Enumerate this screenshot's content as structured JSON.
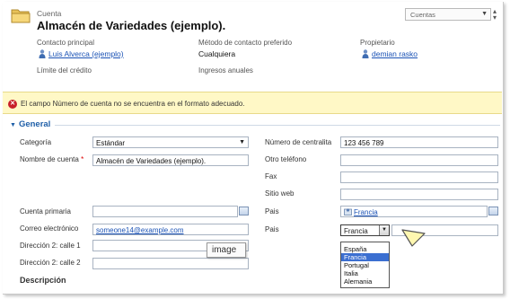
{
  "header": {
    "entity_type": "Cuenta",
    "record_title": "Almacén de Variedades (ejemplo).",
    "nav_dropdown_label": "Cuentas",
    "fields": [
      {
        "label": "Contacto principal",
        "value": "Luis Alverca (ejemplo)"
      },
      {
        "label": "Método de contacto preferido",
        "value": "Cualquiera"
      },
      {
        "label": "Propietario",
        "value": "demian rasko"
      },
      {
        "label": "Límite del crédito",
        "value": ""
      },
      {
        "label": "Ingresos anuales",
        "value": ""
      }
    ]
  },
  "notification": {
    "text": "El campo Número de cuenta no se encuentra en el formato adecuado."
  },
  "section": {
    "title": "General",
    "description_title": "Descripción"
  },
  "form": {
    "left": [
      {
        "label": "Categoría",
        "value": "Estándar"
      },
      {
        "label": "Nombre de cuenta",
        "value": "Almacén de Variedades (ejemplo).",
        "required_mark": "*"
      },
      {
        "label": "Cuenta primaria",
        "value": ""
      },
      {
        "label": "Correo electrónico",
        "value": "someone14@example.com"
      },
      {
        "label": "Dirección 2: calle 1",
        "value": ""
      },
      {
        "label": "Dirección 2: calle 2",
        "value": ""
      }
    ],
    "right": [
      {
        "label": "Número de centralita",
        "value": "123 456 789"
      },
      {
        "label": "Otro teléfono",
        "value": ""
      },
      {
        "label": "Fax",
        "value": ""
      },
      {
        "label": "Sitio web",
        "value": ""
      },
      {
        "label": "Pais",
        "value": "Francia"
      },
      {
        "label": "Pais",
        "value": "Francia"
      }
    ]
  },
  "tooltip": {
    "text": "image"
  },
  "country_dropdown": {
    "selected": "Francia",
    "options": [
      "España",
      "Francia",
      "Portugal",
      "Italia",
      "Alemania"
    ]
  },
  "colors": {
    "accent": "#1f5fa8",
    "link": "#1a52b5",
    "notification_bg": "#fff8c6",
    "error": "#c8202a",
    "selection": "#3b6fd1"
  }
}
